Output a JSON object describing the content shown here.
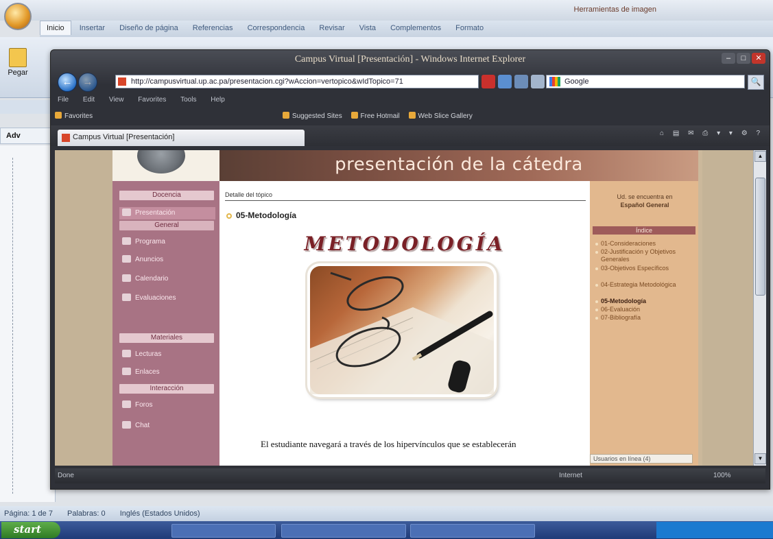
{
  "word": {
    "title": "Herramientas de imagen",
    "ribbon_tabs": [
      "Inicio",
      "Insertar",
      "Diseño de página",
      "Referencias",
      "Correspondencia",
      "Revisar",
      "Vista",
      "Complementos",
      "Formato"
    ],
    "paste_label": "Pegar",
    "left_tab": "Adv",
    "status": {
      "page": "Página: 1 de 7",
      "words": "Palabras: 0",
      "language": "Inglés (Estados Unidos)"
    }
  },
  "taskbar": {
    "start_label": "start"
  },
  "ie": {
    "title": "Campus Virtual [Presentación] - Windows Internet Explorer",
    "url": "http://campusvirtual.up.ac.pa/presentacion.cgi?wAccion=vertopico&wIdTopico=71",
    "search_placeholder": "Google",
    "menu": [
      "File",
      "Edit",
      "View",
      "Favorites",
      "Tools",
      "Help"
    ],
    "favorites_label": "Favorites",
    "favorites": [
      "Suggested Sites",
      "Free Hotmail",
      "Web Slice Gallery"
    ],
    "tab_title": "Campus Virtual [Presentación]",
    "status_done": "Done",
    "status_zone": "Internet",
    "status_zoom": "100%"
  },
  "site": {
    "banner_title": "presentación de la cátedra",
    "nav": {
      "docencia": "Docencia",
      "items_top": [
        "Presentación",
        "Programa",
        "Anuncios",
        "Calendario",
        "Evaluaciones"
      ],
      "materiales_head": "Materiales",
      "items_mid": [
        "Lecturas",
        "Enlaces"
      ],
      "interaccion_head": "Interacción",
      "items_bottom": [
        "Foros",
        "Chat"
      ]
    },
    "main": {
      "detail_label": "Detalle del tópico",
      "topic_title": "05-Metodología",
      "heading": "METODOLOGÍA",
      "body_text": "El estudiante navegará a través de los hipervínculos que se establecerán"
    },
    "right": {
      "located_in": "Ud. se encuentra en",
      "located_value": "Español General",
      "index_head": "Índice",
      "toc": [
        "01-Consideraciones",
        "02-Justificación y Objetivos Generales",
        "03-Objetivos Específicos",
        "04-Estrategia Metodológica",
        "05-Metodología",
        "06-Evaluación",
        "07-Bibliografía"
      ],
      "current_index": 4,
      "users_online": "Usuarios en línea (4)"
    }
  },
  "colors": {
    "nav_bg": "#a87384",
    "right_panel_bg": "#e2b88e",
    "banner_text": "#fbe9dc",
    "heading_color": "#7a2026"
  }
}
